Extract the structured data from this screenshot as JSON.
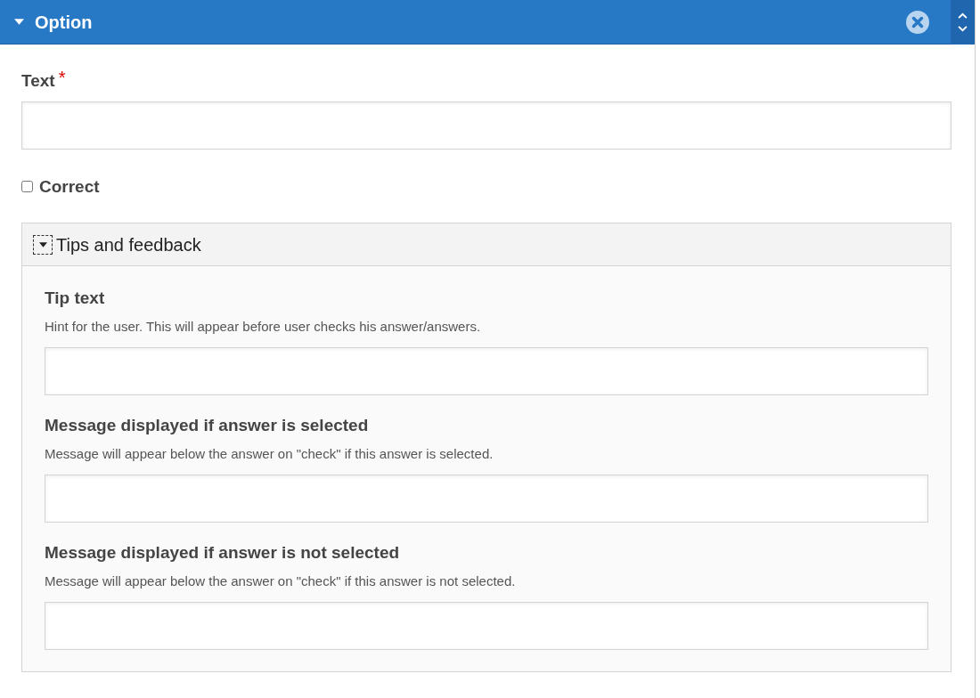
{
  "header": {
    "title": "Option",
    "expanded": true
  },
  "text_field": {
    "label": "Text",
    "required_mark": "*"
  },
  "correct": {
    "label": "Correct",
    "checked": false
  },
  "tips": {
    "title": "Tips and feedback",
    "expanded": true,
    "fields": [
      {
        "label": "Tip text",
        "description": "Hint for the user. This will appear before user checks his answer/answers."
      },
      {
        "label": "Message displayed if answer is selected",
        "description": "Message will appear below the answer on \"check\" if this answer is selected."
      },
      {
        "label": "Message displayed if answer is not selected",
        "description": "Message will appear below the answer on \"check\" if this answer is not selected."
      }
    ]
  }
}
